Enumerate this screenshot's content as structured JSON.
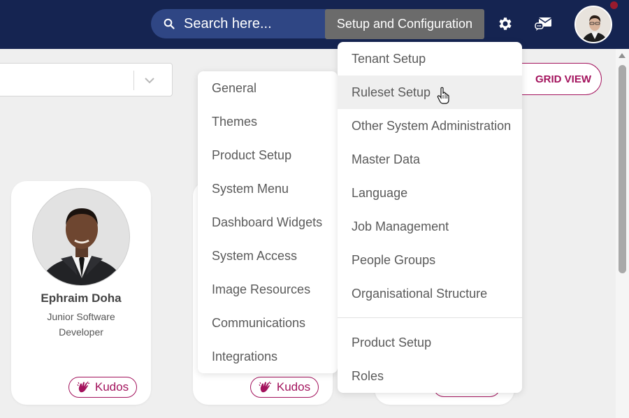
{
  "header": {
    "search_placeholder": "Search here...",
    "tooltip": "Setup and Configuration",
    "icons": [
      "search-icon",
      "gear-icon",
      "messages-icon",
      "avatar"
    ]
  },
  "toolbar": {
    "grid_view_label": "GRID VIEW"
  },
  "cards": [
    {
      "name": "Ephraim Doha",
      "role": "Junior Software Developer",
      "kudos_label": "Kudos"
    },
    {
      "name": "",
      "role": "",
      "kudos_label": "Kudos"
    }
  ],
  "menu_left": {
    "items": [
      "General",
      "Themes",
      "Product Setup",
      "System Menu",
      "Dashboard Widgets",
      "System Access",
      "Image Resources",
      "Communications",
      "Integrations"
    ]
  },
  "menu_right": {
    "items": [
      "Tenant Setup",
      "Ruleset Setup",
      "Other System Administration",
      "Master Data",
      "Language",
      "Job Management",
      "People Groups",
      "Organisational Structure"
    ],
    "items_after_divider": [
      "Product Setup",
      "Roles"
    ],
    "hovered": "Ruleset Setup"
  },
  "colors": {
    "topbar": "#152451",
    "search_bg": "#2f4684",
    "accent": "#a3135d",
    "tooltip_bg": "#6b6b6b"
  }
}
